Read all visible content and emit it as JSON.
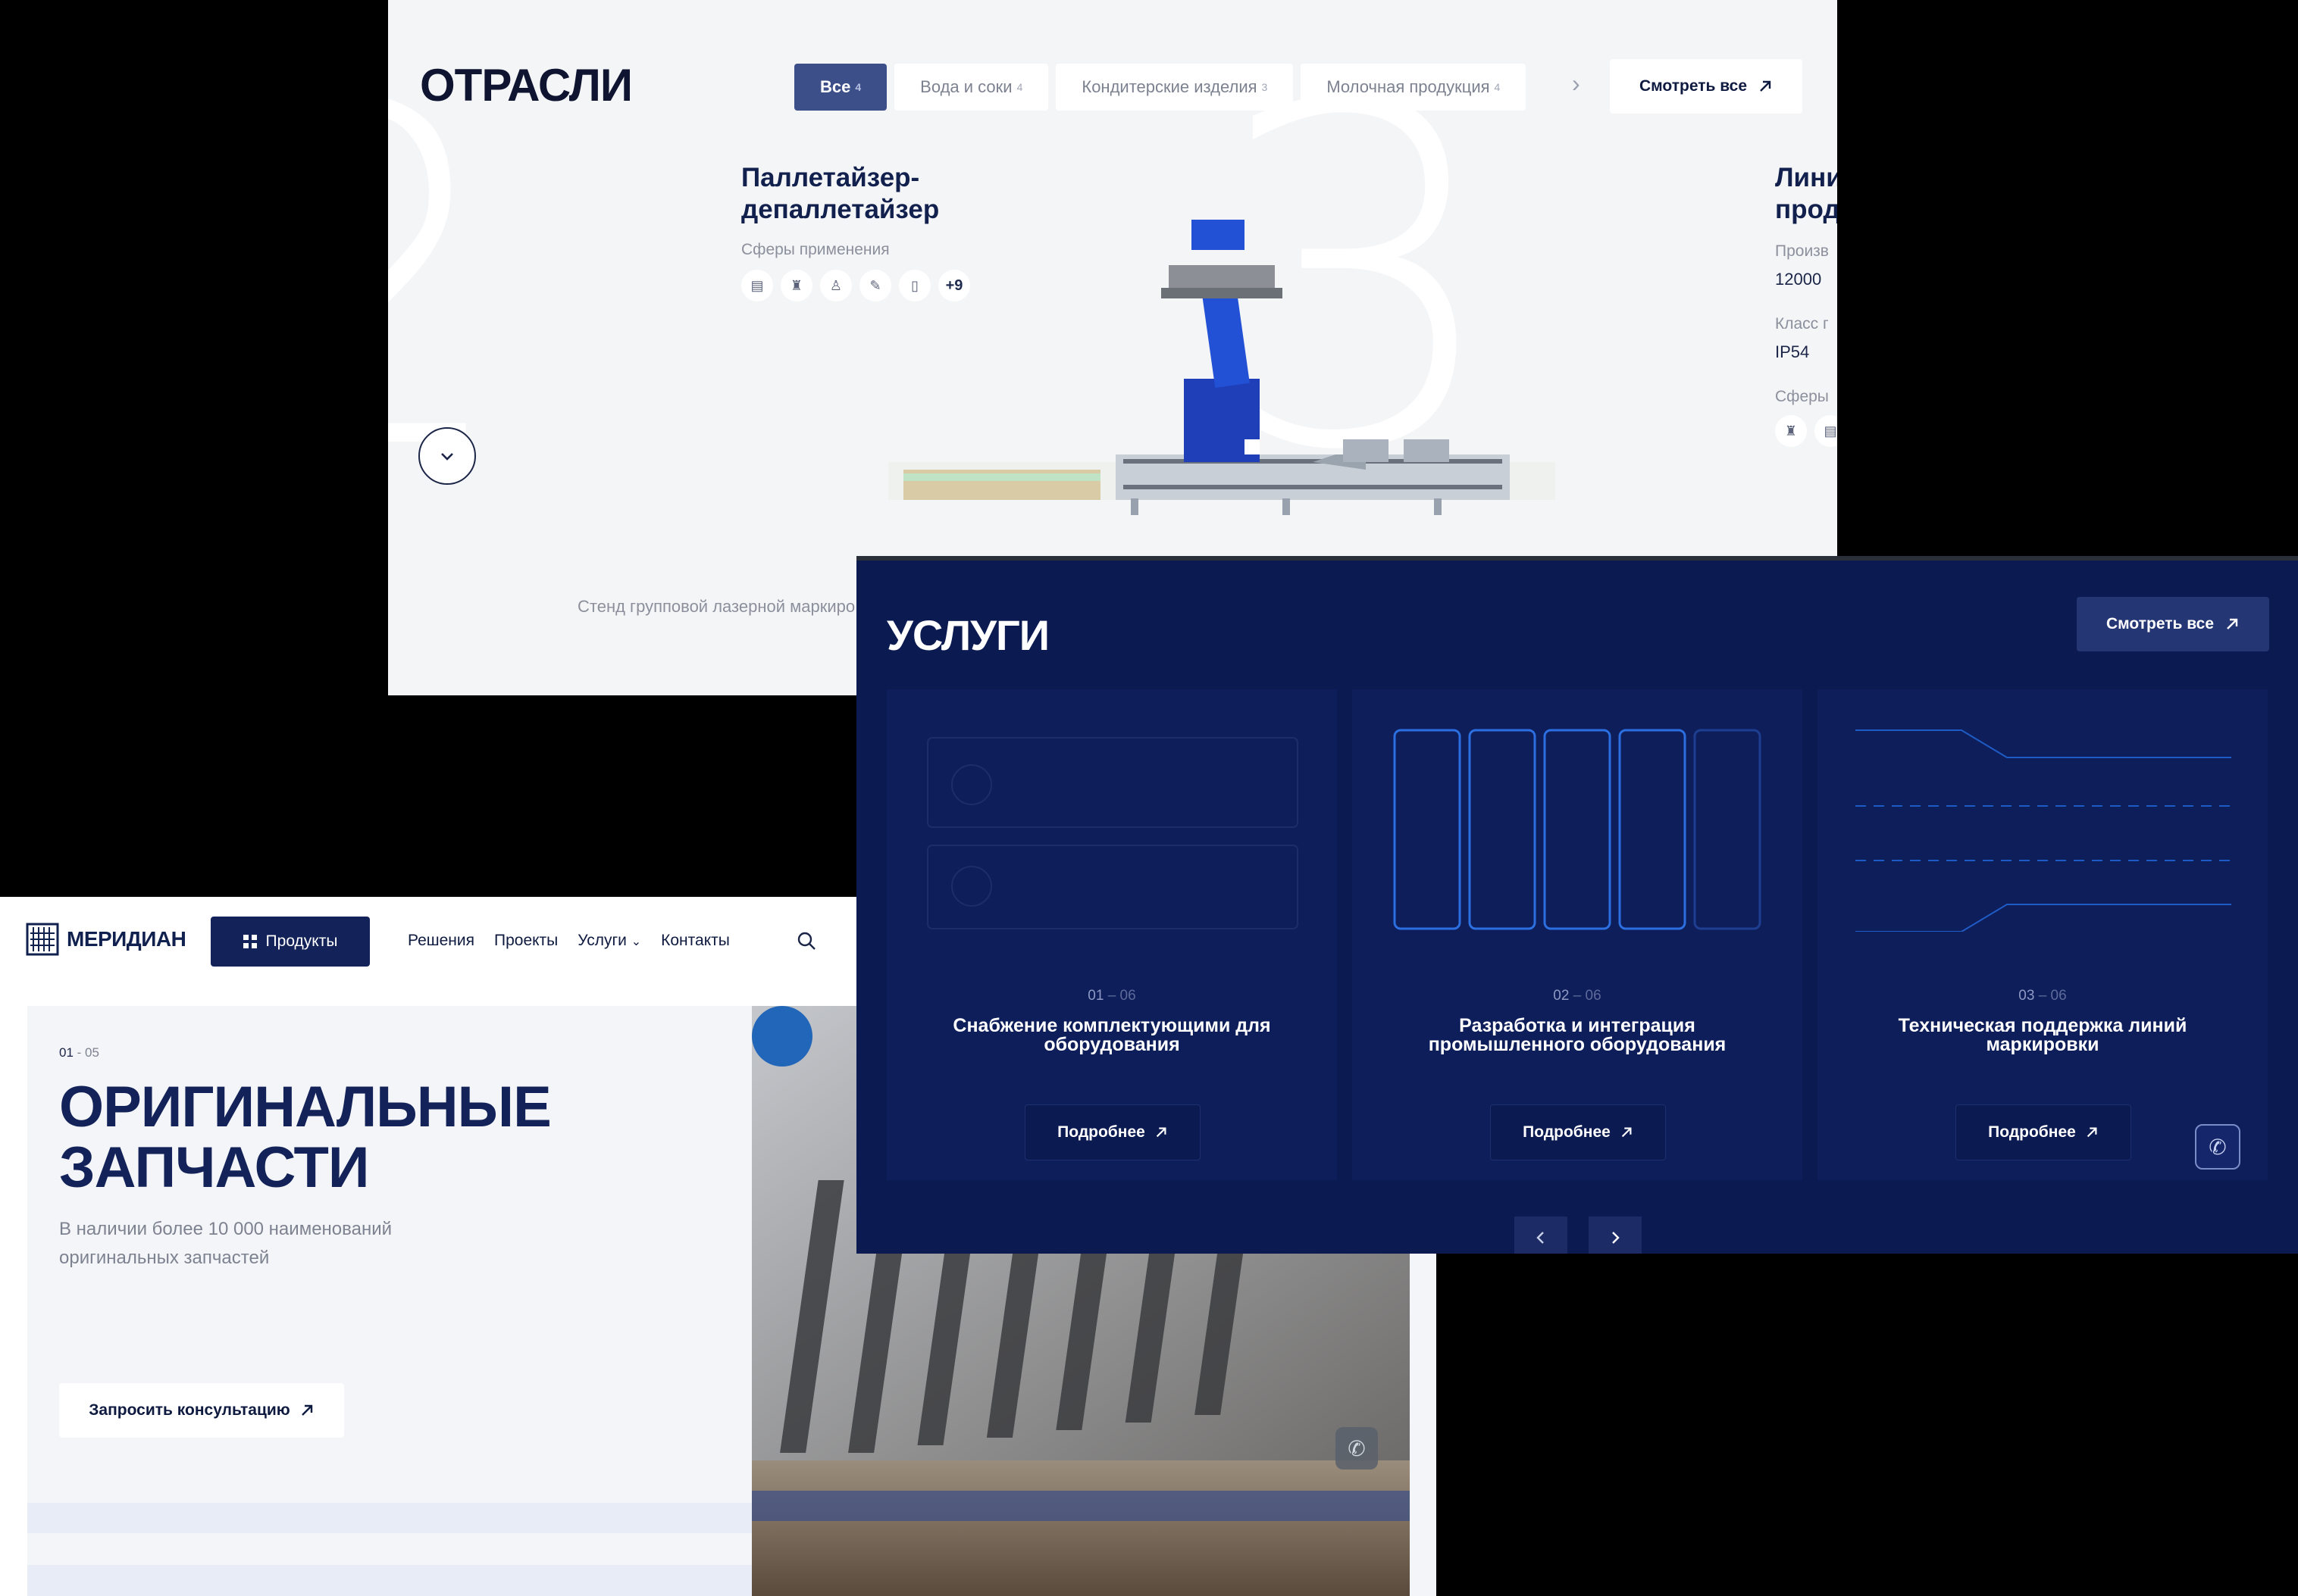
{
  "industries": {
    "title": "ОТРАСЛИ",
    "filters": [
      {
        "label": "Все",
        "count": "4"
      },
      {
        "label": "Вода и соки",
        "count": "4"
      },
      {
        "label": "Кондитерские изделия",
        "count": "3"
      },
      {
        "label": "Молочная продукция",
        "count": "4"
      }
    ],
    "see_all_label": "Смотреть все",
    "bg_number": "3",
    "product1": {
      "title_line1": "Паллетайзер-",
      "title_line2": "депаллетайзер",
      "spheres_label": "Сферы применения",
      "spheres_more": "+9"
    },
    "product2": {
      "title_line1": "Лини",
      "title_line2": "прод",
      "prod_label": "Произв",
      "prod_value": "12000",
      "class_label": "Класс г",
      "class_value": "IP54",
      "spheres_label": "Сферы"
    },
    "caption": "Стенд групповой лазерной маркиро"
  },
  "home": {
    "logo_text": "МЕРИДИАН",
    "products_label": "Продукты",
    "nav": [
      "Решения",
      "Проекты",
      "Услуги",
      "Контакты"
    ],
    "hero": {
      "counter_current": "01",
      "counter_sep": " - ",
      "counter_total": "05",
      "title_line1": "ОРИГИНАЛЬНЫЕ",
      "title_line2": "ЗАПЧАСТИ",
      "subtitle": "В наличии более 10 000 наименований оригинальных запчастей",
      "cta_label": "Запросить консультацию"
    }
  },
  "services": {
    "title": "УСЛУГИ",
    "see_all_label": "Смотреть все",
    "cards": [
      {
        "num": "01",
        "total": " – 06",
        "title": "Снабжение комплектующими для оборудования",
        "button": "Подробнее"
      },
      {
        "num": "02",
        "total": " – 06",
        "title": "Разработка и интеграция промышленного оборудования",
        "button": "Подробнее"
      },
      {
        "num": "03",
        "total": " – 06",
        "title": "Техническая поддержка линий маркировки",
        "button": "Подробнее"
      }
    ]
  },
  "colors": {
    "navy": "#132359",
    "services_bg": "#0c1a52",
    "active_chip": "#3d4f88",
    "hero_bg": "#f4f5f8"
  }
}
